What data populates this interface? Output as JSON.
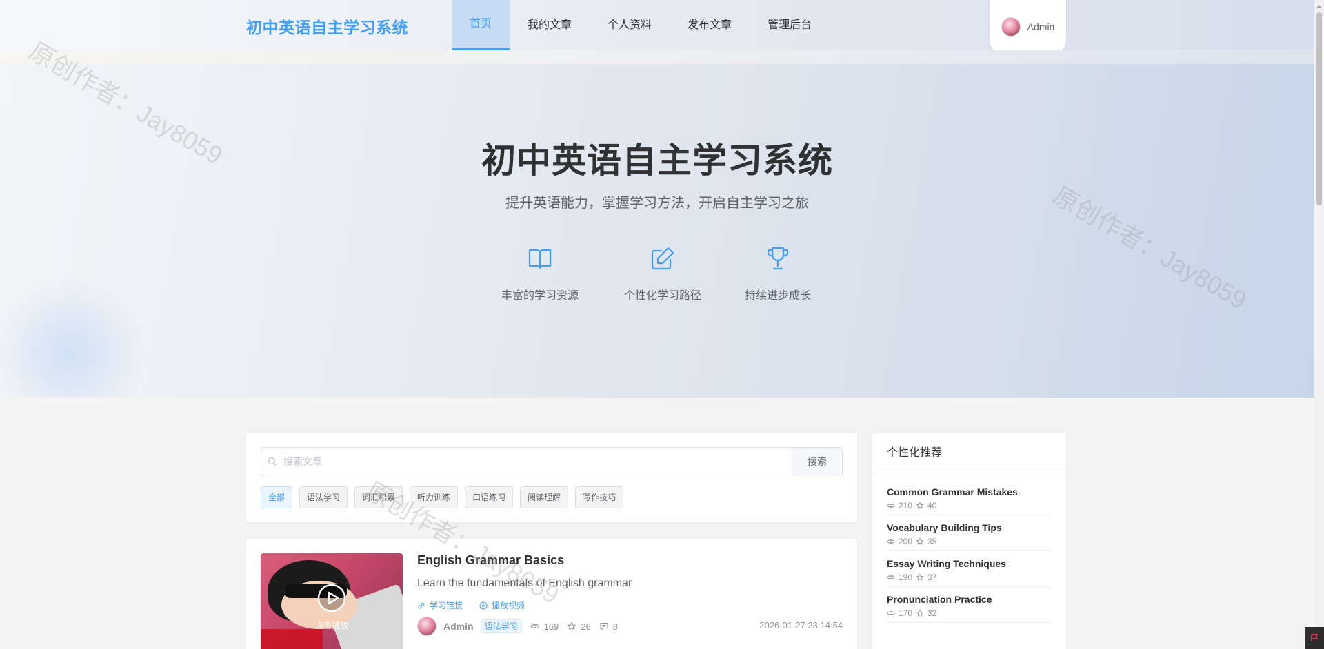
{
  "header": {
    "brand": "初中英语自主学习系统",
    "nav": [
      {
        "label": "首页"
      },
      {
        "label": "我的文章"
      },
      {
        "label": "个人资料"
      },
      {
        "label": "发布文章"
      },
      {
        "label": "管理后台"
      }
    ],
    "user": {
      "name": "Admin"
    }
  },
  "hero": {
    "title": "初中英语自主学习系统",
    "subtitle": "提升英语能力，掌握学习方法，开启自主学习之旅",
    "features": [
      {
        "label": "丰富的学习资源",
        "icon": "book-open-icon"
      },
      {
        "label": "个性化学习路径",
        "icon": "edit-icon"
      },
      {
        "label": "持续进步成长",
        "icon": "trophy-icon"
      }
    ]
  },
  "watermark": "原创作者：Jay8059",
  "search": {
    "placeholder": "搜索文章",
    "button": "搜索",
    "categories": [
      {
        "label": "全部"
      },
      {
        "label": "语法学习"
      },
      {
        "label": "词汇积累"
      },
      {
        "label": "听力训练"
      },
      {
        "label": "口语练习"
      },
      {
        "label": "阅读理解"
      },
      {
        "label": "写作技巧"
      }
    ]
  },
  "article": {
    "title": "English Grammar Basics",
    "description": "Learn the fundamentals of English grammar",
    "study_link": "学习链接",
    "play_video": "播放视频",
    "thumb_label": "点击播放",
    "author": "Admin",
    "tag": "语法学习",
    "views": "169",
    "stars": "26",
    "comments": "8",
    "date": "2026-01-27 23:14:54"
  },
  "recommend": {
    "title": "个性化推荐",
    "items": [
      {
        "title": "Common Grammar Mistakes",
        "views": "210",
        "stars": "40"
      },
      {
        "title": "Vocabulary Building Tips",
        "views": "200",
        "stars": "35"
      },
      {
        "title": "Essay Writing Techniques",
        "views": "190",
        "stars": "37"
      },
      {
        "title": "Pronunciation Practice",
        "views": "170",
        "stars": "32"
      }
    ]
  },
  "colors": {
    "accent": "#409eff",
    "text": "#303133",
    "muted": "#909399"
  }
}
